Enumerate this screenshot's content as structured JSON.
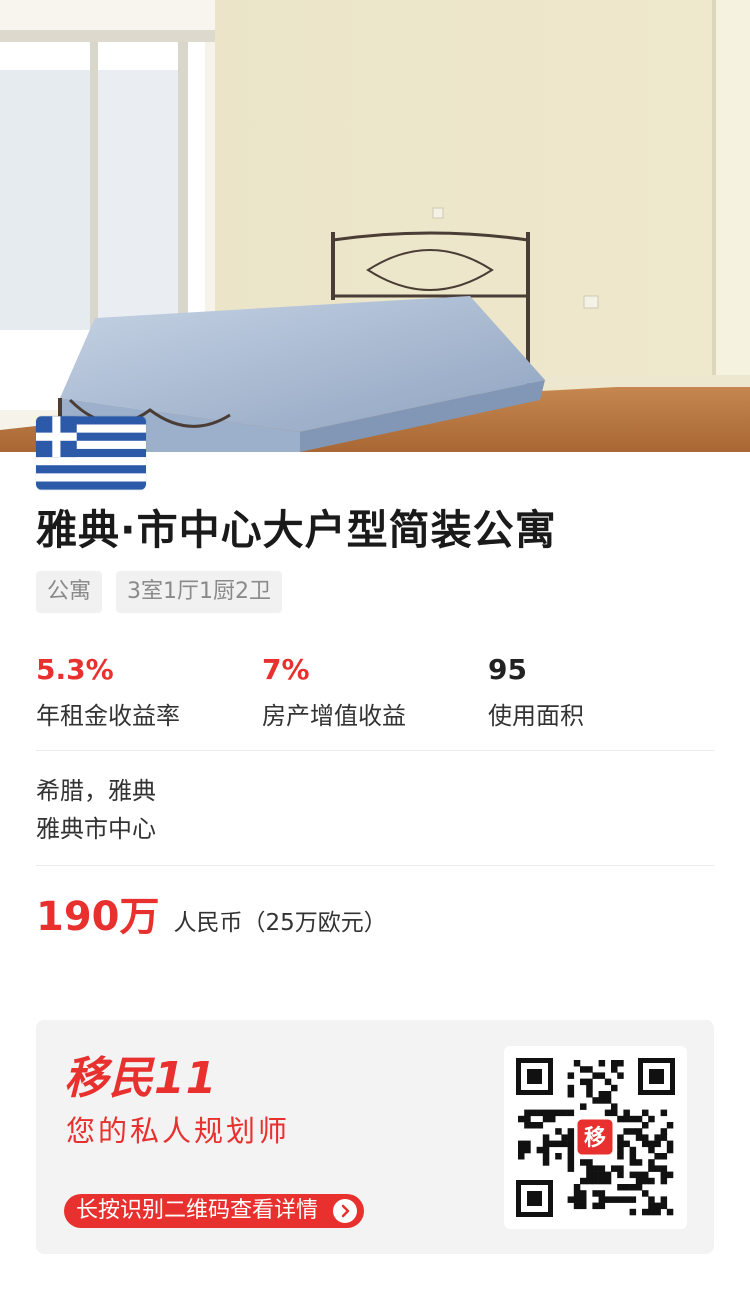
{
  "listing": {
    "title": "雅典·市中心大户型简装公寓",
    "tags": [
      "公寓",
      "3室1厅1厨2卫"
    ],
    "stats": [
      {
        "value": "5.3%",
        "label": "年租金收益率"
      },
      {
        "value": "7%",
        "label": "房产增值收益"
      },
      {
        "value": "95",
        "label": "使用面积"
      }
    ],
    "location": {
      "line1": "希腊，雅典",
      "line2": "雅典市中心"
    },
    "price": {
      "amount": "190万",
      "unit": "人民币（25万欧元）"
    }
  },
  "promo": {
    "brand": "移民11",
    "slogan": "您的私人规划师",
    "cta": "长按识别二维码查看详情",
    "qr_badge": "移"
  },
  "colors": {
    "accent": "#e8312f",
    "greek_blue": "#2c5aa8"
  },
  "icons": {
    "flag": "greece-flag-icon",
    "arrow": "chevron-right-icon"
  }
}
